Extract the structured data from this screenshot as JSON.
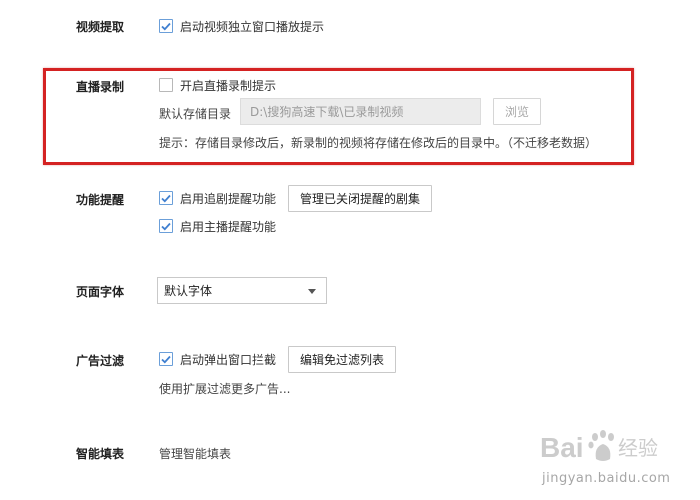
{
  "video_extract": {
    "label": "视频提取",
    "option": {
      "label": "启动视频独立窗口播放提示",
      "checked": true
    }
  },
  "live_record": {
    "label": "直播录制",
    "option": {
      "label": "开启直播录制提示",
      "checked": false
    },
    "default_dir_label": "默认存储目录",
    "path_value": "D:\\搜狗高速下载\\已录制视频",
    "browse_button": "浏览",
    "hint": "提示：存储目录修改后，新录制的视频将存储在修改后的目录中。（不迁移老数据）"
  },
  "function_reminder": {
    "label": "功能提醒",
    "option1": {
      "label": "启用追剧提醒功能",
      "checked": true
    },
    "manage_button": "管理已关闭提醒的剧集",
    "option2": {
      "label": "启用主播提醒功能",
      "checked": true
    }
  },
  "page_font": {
    "label": "页面字体",
    "selected": "默认字体"
  },
  "ad_filter": {
    "label": "广告过滤",
    "option": {
      "label": "启动弹出窗口拦截",
      "checked": true
    },
    "edit_button": "编辑免过滤列表",
    "more_link": "使用扩展过滤更多广告..."
  },
  "smart_fill": {
    "label": "智能填表",
    "manage_link": "管理智能填表"
  },
  "colors": {
    "highlight": "#d42222",
    "check": "#3f7fd0",
    "disabled_input_bg": "#ececec"
  },
  "watermark": {
    "logo_text": "Bai",
    "logo_cn": "经验",
    "url": "jingyan.baidu.com"
  }
}
